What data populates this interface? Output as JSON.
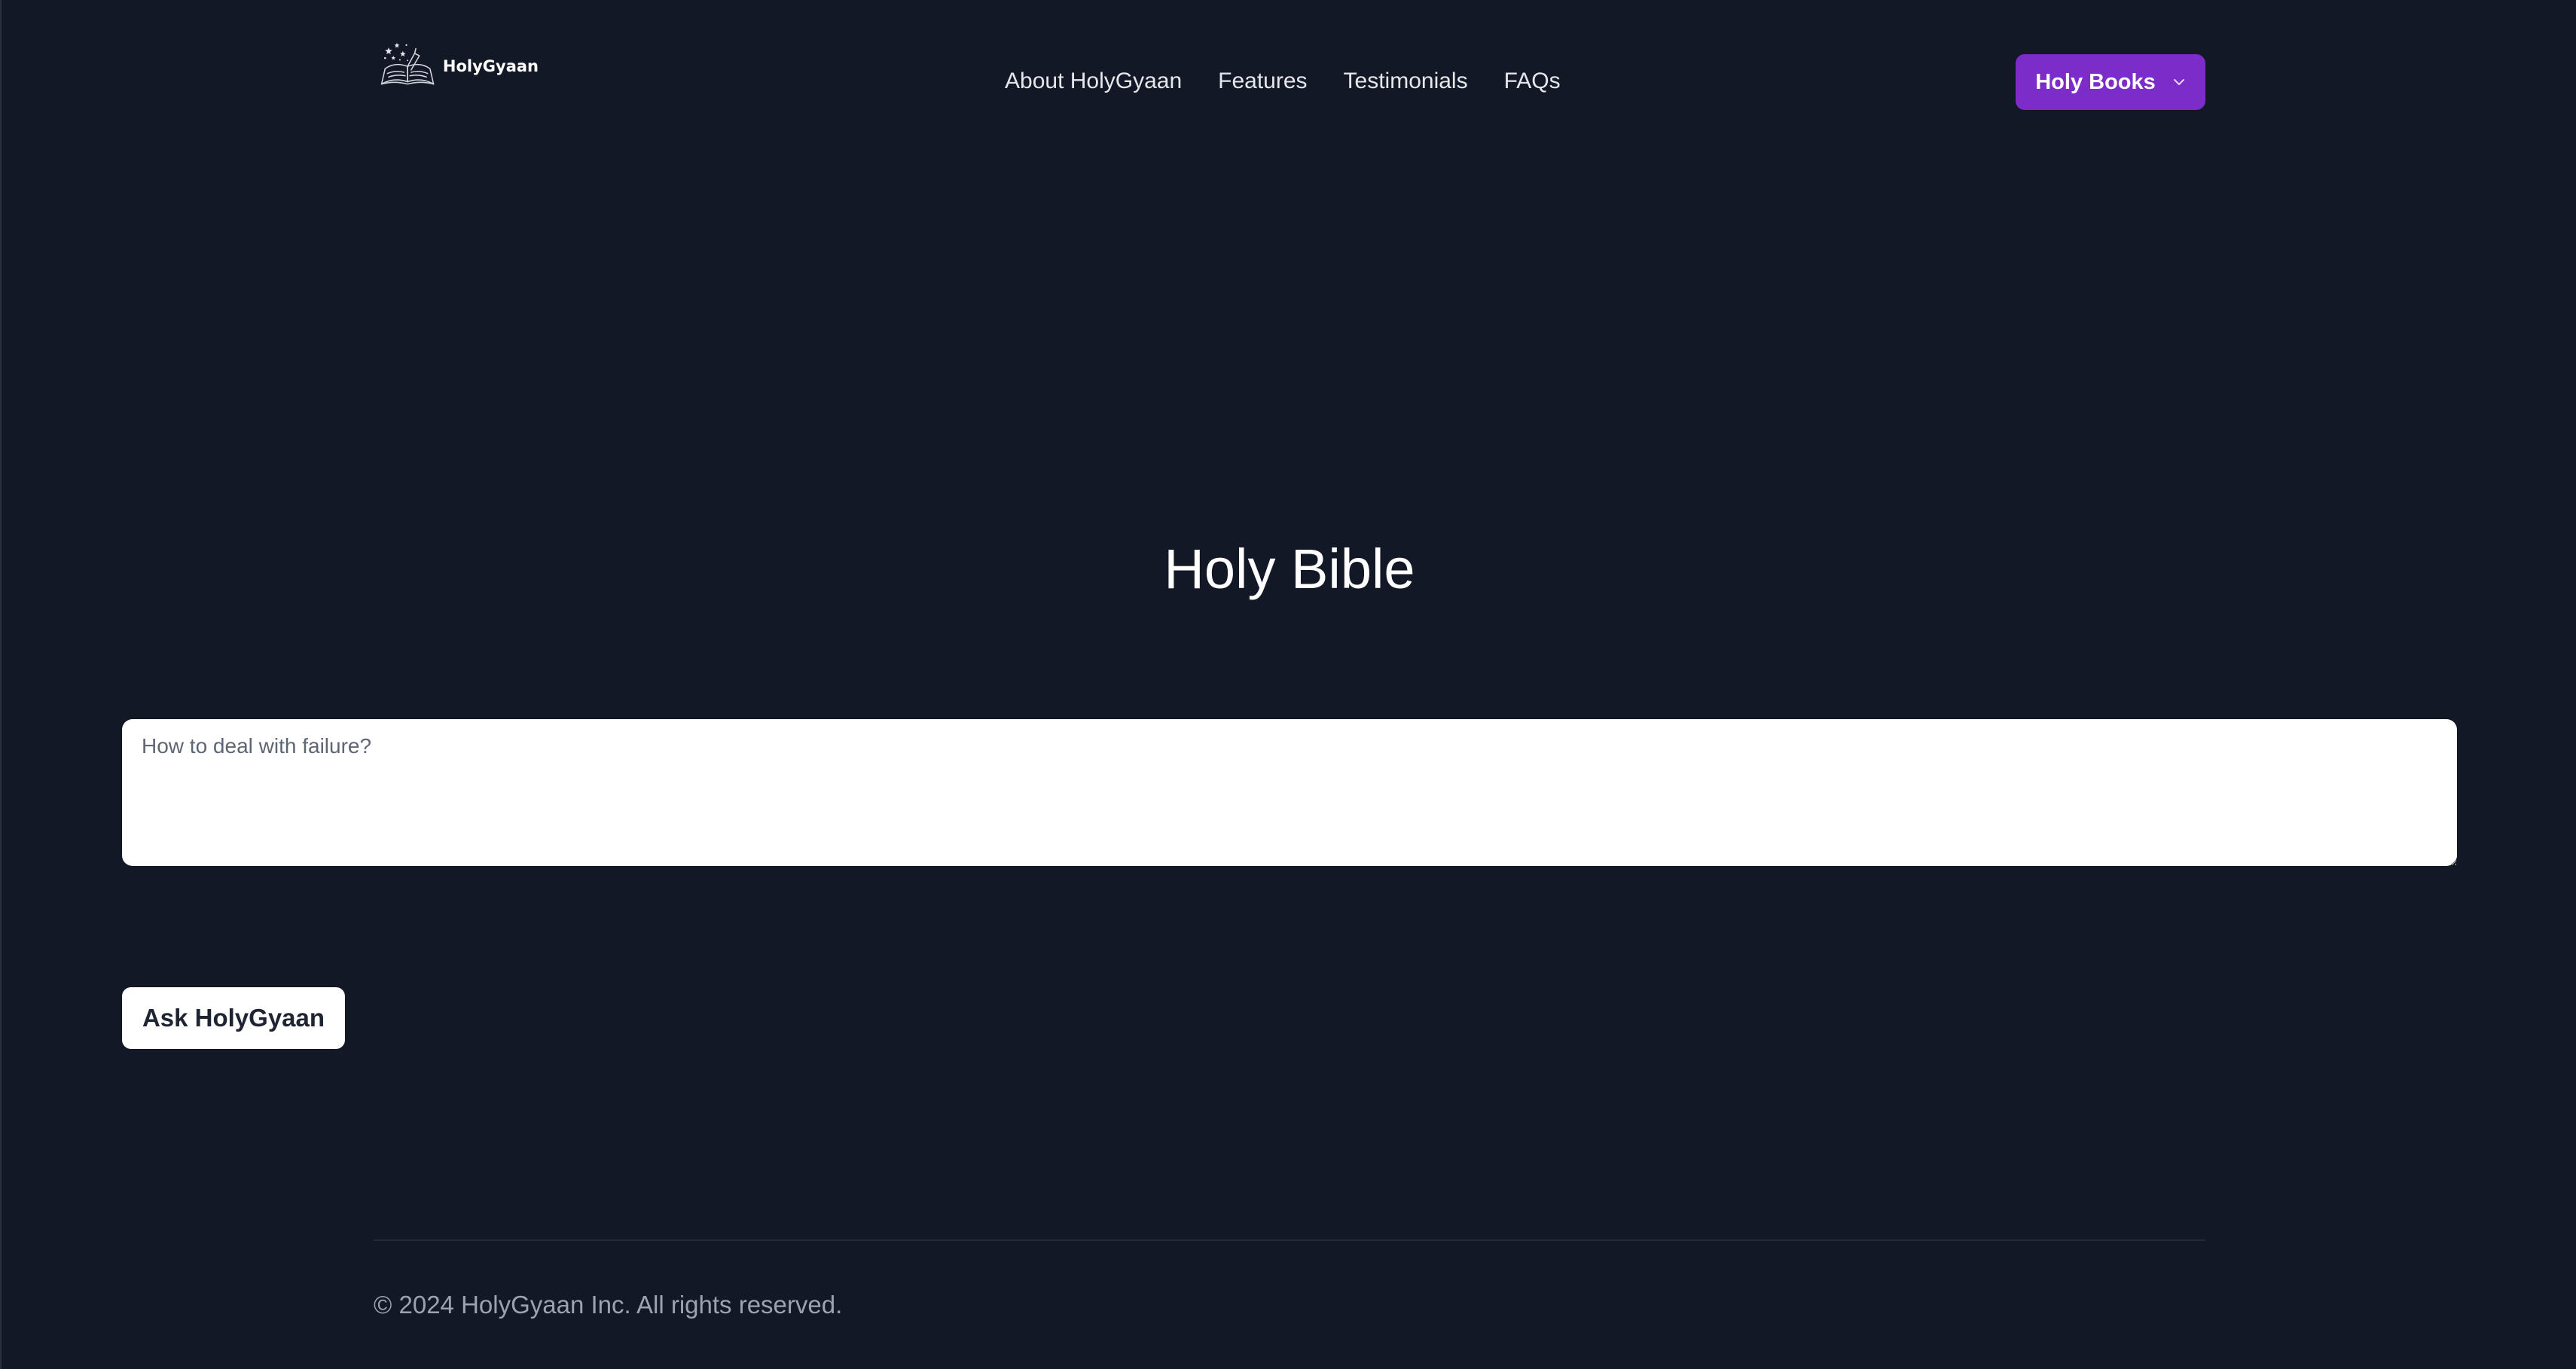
{
  "header": {
    "logo_text": "HolyGyaan",
    "nav": [
      {
        "label": "About HolyGyaan"
      },
      {
        "label": "Features"
      },
      {
        "label": "Testimonials"
      },
      {
        "label": "FAQs"
      }
    ],
    "books_button": {
      "label": "Holy Books",
      "icon": "chevron-down-icon"
    }
  },
  "hero": {
    "title": "Holy Bible"
  },
  "question": {
    "placeholder": "How to deal with failure?",
    "value": ""
  },
  "ask_button": {
    "label": "Ask HolyGyaan"
  },
  "footer": {
    "copyright": "© 2024 HolyGyaan Inc. All rights reserved."
  },
  "colors": {
    "background": "#131827",
    "accent": "#7b2cc9",
    "text_primary": "#ffffff",
    "text_muted": "#9ca3af"
  }
}
